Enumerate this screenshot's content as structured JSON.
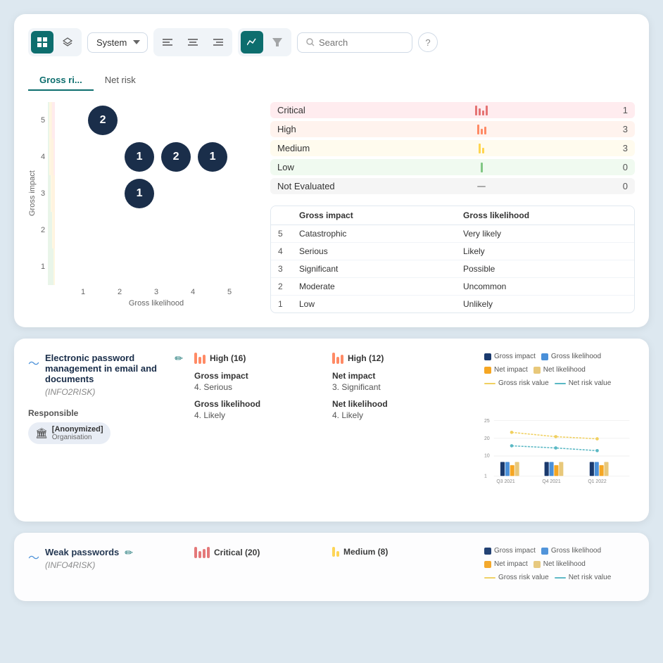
{
  "toolbar": {
    "view_grid_label": "grid-view",
    "view_layer_label": "layer-view",
    "dropdown_options": [
      "System"
    ],
    "dropdown_selected": "System",
    "align_left_label": "align-left",
    "align_center_label": "align-center",
    "align_right_label": "align-right",
    "chart_label": "chart-view",
    "filter_label": "filter",
    "search_placeholder": "Search",
    "help_label": "?"
  },
  "tabs": [
    {
      "id": "gross",
      "label": "Gross ri..."
    },
    {
      "id": "net",
      "label": "Net risk"
    }
  ],
  "matrix": {
    "y_labels": [
      "5",
      "4",
      "3",
      "2",
      "1"
    ],
    "x_labels": [
      "1",
      "2",
      "3",
      "4",
      "5"
    ],
    "y_axis_label": "Gross impact",
    "x_axis_label": "Gross likelihood",
    "bubbles": [
      {
        "x": 2,
        "y": 5,
        "count": 2
      },
      {
        "x": 3,
        "y": 4,
        "count": 1
      },
      {
        "x": 4,
        "y": 4,
        "count": 2
      },
      {
        "x": 5,
        "y": 4,
        "count": 1
      },
      {
        "x": 3,
        "y": 3,
        "count": 1
      }
    ],
    "colors": {
      "row5": [
        "#c8e6c9",
        "#ffecb3",
        "#ffe0b2",
        "#ffcdd2",
        "#ffcdd2"
      ],
      "row4": [
        "#c8e6c9",
        "#ffecb3",
        "#ffe0b2",
        "#ffe0b2",
        "#ffcdd2"
      ],
      "row3": [
        "#c8e6c9",
        "#c8e6c9",
        "#ffecb3",
        "#ffe0b2",
        "#ffe0b2"
      ],
      "row2": [
        "#c8e6c9",
        "#c8e6c9",
        "#c8e6c9",
        "#ffecb3",
        "#ffe0b2"
      ],
      "row1": [
        "#c8e6c9",
        "#c8e6c9",
        "#c8e6c9",
        "#c8e6c9",
        "#ffecb3"
      ]
    }
  },
  "legend": {
    "items": [
      {
        "label": "Critical",
        "color": "#ffcdd2",
        "swatch_color": "#e57373",
        "count": 1
      },
      {
        "label": "High",
        "color": "#ffe0b2",
        "swatch_color": "#ff8a65",
        "count": 3
      },
      {
        "label": "Medium",
        "color": "#ffecb3",
        "swatch_color": "#ffd54f",
        "count": 3
      },
      {
        "label": "Low",
        "color": "#c8e6c9",
        "swatch_color": "#81c784",
        "count": 0
      },
      {
        "label": "Not Evaluated",
        "color": "#e0e0e0",
        "swatch_color": "#bdbdbd",
        "count": 0
      }
    ]
  },
  "impact_table": {
    "headers": [
      "",
      "Gross impact",
      "Gross likelihood"
    ],
    "rows": [
      {
        "num": "5",
        "impact": "Catastrophic",
        "likelihood": "Very likely"
      },
      {
        "num": "4",
        "impact": "Serious",
        "likelihood": "Likely"
      },
      {
        "num": "3",
        "impact": "Significant",
        "likelihood": "Possible"
      },
      {
        "num": "2",
        "impact": "Moderate",
        "likelihood": "Uncommon"
      },
      {
        "num": "1",
        "impact": "Low",
        "likelihood": "Unlikely"
      }
    ]
  },
  "risk_items": [
    {
      "id": "item1",
      "title": "Electronic password management in email and documents",
      "code": "INFO2RISK",
      "responsible_label": "Responsible",
      "org_label": "[Anonymized]",
      "org_sub": "Organisation",
      "gross_badge": "High (16)",
      "gross_color": "#ff8a65",
      "gross_impact_label": "Gross impact",
      "gross_impact_value": "4. Serious",
      "gross_likelihood_label": "Gross likelihood",
      "gross_likelihood_value": "4. Likely",
      "net_badge": "High (12)",
      "net_color": "#ff8a65",
      "net_impact_label": "Net impact",
      "net_impact_value": "3. Significant",
      "net_likelihood_label": "Net likelihood",
      "net_likelihood_value": "4. Likely",
      "chart": {
        "legend": [
          {
            "label": "Gross impact",
            "color": "#1a3a6e",
            "type": "bar"
          },
          {
            "label": "Gross likelihood",
            "color": "#4a90d9",
            "type": "bar"
          },
          {
            "label": "Net impact",
            "color": "#f5a623",
            "type": "bar"
          },
          {
            "label": "Net likelihood",
            "color": "#e8c87a",
            "type": "bar"
          },
          {
            "label": "Gross risk value",
            "color": "#f0d060",
            "type": "line"
          },
          {
            "label": "Net risk value",
            "color": "#5ab8c4",
            "type": "line"
          }
        ],
        "periods": [
          "Q3 2021",
          "Q4 2021",
          "Q1 2022"
        ],
        "gross_impact": [
          4,
          4,
          4
        ],
        "gross_likelihood": [
          4,
          4,
          4
        ],
        "net_impact": [
          3,
          3,
          3
        ],
        "net_likelihood": [
          4,
          4,
          4
        ],
        "gross_risk_value": [
          20,
          18,
          17
        ],
        "net_risk_value": [
          14,
          13,
          12
        ]
      }
    }
  ],
  "risk_items_preview": [
    {
      "id": "item2",
      "title": "Weak passwords",
      "code": "INFO4RISK",
      "critical_badge": "Critical (20)",
      "medium_badge": "Medium (8)",
      "chart_legend": [
        {
          "label": "Gross impact",
          "color": "#1a3a6e",
          "type": "bar"
        },
        {
          "label": "Gross likelihood",
          "color": "#4a90d9",
          "type": "bar"
        },
        {
          "label": "Net impact",
          "color": "#f5a623",
          "type": "bar"
        },
        {
          "label": "Net likelihood",
          "color": "#e8c87a",
          "type": "bar"
        },
        {
          "label": "Gross risk value",
          "color": "#f0d060",
          "type": "line"
        },
        {
          "label": "Net risk value",
          "color": "#5ab8c4",
          "type": "line"
        }
      ]
    }
  ]
}
